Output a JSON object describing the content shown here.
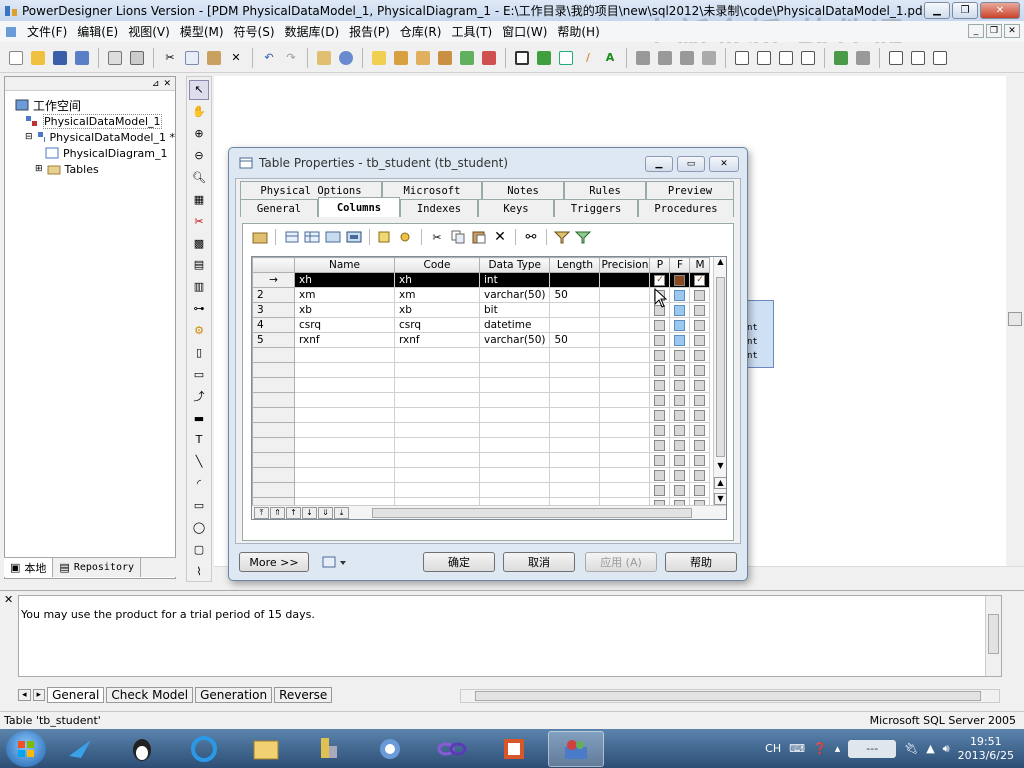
{
  "window": {
    "title": "PowerDesigner Lions Version - [PDM PhysicalDataModel_1, PhysicalDiagram_1 - E:\\工作目录\\我的项目\\new\\sql2012\\未录制\\code\\PhysicalDataModel_1.pd..."
  },
  "watermark": "中新金桥 软件通",
  "menu": [
    "文件(F)",
    "编辑(E)",
    "视图(V)",
    "模型(M)",
    "符号(S)",
    "数据库(D)",
    "报告(P)",
    "仓库(R)",
    "工具(T)",
    "窗口(W)",
    "帮助(H)"
  ],
  "browser": {
    "root": "工作空间",
    "items": [
      "PhysicalDataModel_1",
      "PhysicalDataModel_1 *",
      "PhysicalDiagram_1",
      "Tables"
    ],
    "tabs": [
      "本地",
      "Repository"
    ]
  },
  "diagram": {
    "entity_lines": [
      "nt",
      "nt",
      "nt"
    ]
  },
  "dialog": {
    "title": "Table Properties - tb_student (tb_student)",
    "tabs_top": [
      "Physical Options",
      "Microsoft",
      "Notes",
      "Rules",
      "Preview"
    ],
    "tabs_bottom": [
      "General",
      "Columns",
      "Indexes",
      "Keys",
      "Triggers",
      "Procedures"
    ],
    "columns": {
      "headers": [
        "Name",
        "Code",
        "Data Type",
        "Length",
        "Precision",
        "P",
        "F",
        "M"
      ],
      "current_marker": "→",
      "rows": [
        {
          "num": "",
          "name": "xh",
          "code": "xh",
          "type": "int",
          "length": "",
          "precision": ""
        },
        {
          "num": "2",
          "name": "xm",
          "code": "xm",
          "type": "varchar(50)",
          "length": "50",
          "precision": ""
        },
        {
          "num": "3",
          "name": "xb",
          "code": "xb",
          "type": "bit",
          "length": "",
          "precision": ""
        },
        {
          "num": "4",
          "name": "csrq",
          "code": "csrq",
          "type": "datetime",
          "length": "",
          "precision": ""
        },
        {
          "num": "5",
          "name": "rxnf",
          "code": "rxnf",
          "type": "varchar(50)",
          "length": "50",
          "precision": ""
        }
      ]
    },
    "buttons": {
      "more": "More >>",
      "ok": "确定",
      "cancel": "取消",
      "apply": "应用 (A)",
      "help": "帮助"
    }
  },
  "output": {
    "message": "You may use the product for a trial period of 15 days.",
    "tabs": [
      "General",
      "Check Model",
      "Generation",
      "Reverse"
    ]
  },
  "status": {
    "left": "Table 'tb_student'",
    "right": "Microsoft SQL Server 2005"
  },
  "taskbar": {
    "lang": "CH",
    "time": "19:51",
    "date": "2013/6/25"
  },
  "colors": {
    "title_gradient_top": "#dfe9f6",
    "selection": "#000000",
    "checkbox_blue": "#9cc7ef",
    "entity_fill": "#cfe0f5"
  }
}
